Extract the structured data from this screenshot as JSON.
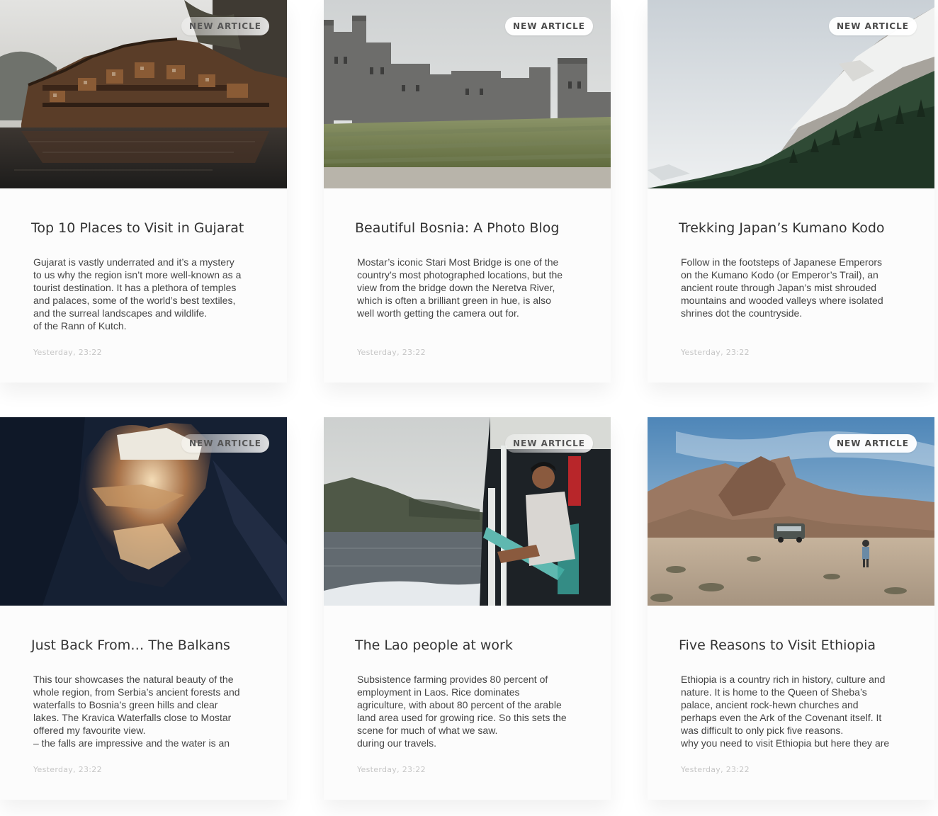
{
  "articles": [
    {
      "badge": "NEW ARTICLE",
      "image": "riverside-wooden-village-photo",
      "title": "Top 10 Places to Visit in Gujarat",
      "excerpt": [
        "Gujarat is vastly underrated and it’s a mystery",
        "to us why the region isn’t more well-known as a",
        "tourist destination. It has a plethora of temples",
        "and palaces, some of the world’s best textiles,",
        "and the surreal landscapes and wildlife.",
        " of the Rann of Kutch."
      ],
      "date": "Yesterday, 23:22"
    },
    {
      "badge": "NEW ARTICLE",
      "image": "castle-lawn-photo",
      "title": "Beautiful Bosnia: A Photo Blog",
      "excerpt": [
        "Mostar’s iconic Stari Most Bridge is one of the",
        "country’s most photographed locations, but the",
        "view from the bridge down the Neretva River,",
        "which is often a brilliant green in hue, is also",
        "well worth getting the camera out for."
      ],
      "date": "Yesterday, 23:22"
    },
    {
      "badge": "NEW ARTICLE",
      "image": "snowy-mountain-forest-photo",
      "title": "Trekking Japan’s Kumano Kodo",
      "excerpt": [
        "Follow in the footsteps of Japanese Emperors",
        "on the Kumano Kodo (or Emperor’s Trail), an",
        "ancient route through Japan’s mist shrouded",
        "mountains and wooded valleys where isolated",
        "shrines dot the countryside."
      ],
      "date": "Yesterday, 23:22"
    },
    {
      "badge": "NEW ARTICLE",
      "image": "cave-opening-sunlight-photo",
      "title": "Just Back From… The Balkans",
      "excerpt": [
        "This tour showcases the natural beauty of the",
        "whole region, from Serbia’s ancient forests and",
        "waterfalls to Bosnia’s green hills and clear",
        "lakes. The Kravica Waterfalls close to Mostar",
        "offered my favourite view.",
        "– the falls are impressive and the water is an"
      ],
      "date": "Yesterday, 23:22"
    },
    {
      "badge": "NEW ARTICLE",
      "image": "man-on-boat-river-photo",
      "title": "The Lao people at work",
      "excerpt": [
        "Subsistence farming provides 80 percent of",
        "employment in Laos. Rice dominates",
        "agriculture, with about 80 percent of the arable",
        "land area used for growing rice. So this sets the",
        "scene for much of what we saw.",
        " during our travels."
      ],
      "date": "Yesterday, 23:22"
    },
    {
      "badge": "NEW ARTICLE",
      "image": "desert-rocks-van-photo",
      "title": "Five Reasons to Visit Ethiopia",
      "excerpt": [
        "Ethiopia is a country rich in history, culture and",
        "nature. It is home to the Queen of Sheba’s",
        "palace, ancient rock-hewn churches and",
        "perhaps even the Ark of the Covenant itself. It",
        "was difficult to only pick five reasons.",
        "why you need to visit Ethiopia but here they are"
      ],
      "date": "Yesterday, 23:22"
    }
  ]
}
